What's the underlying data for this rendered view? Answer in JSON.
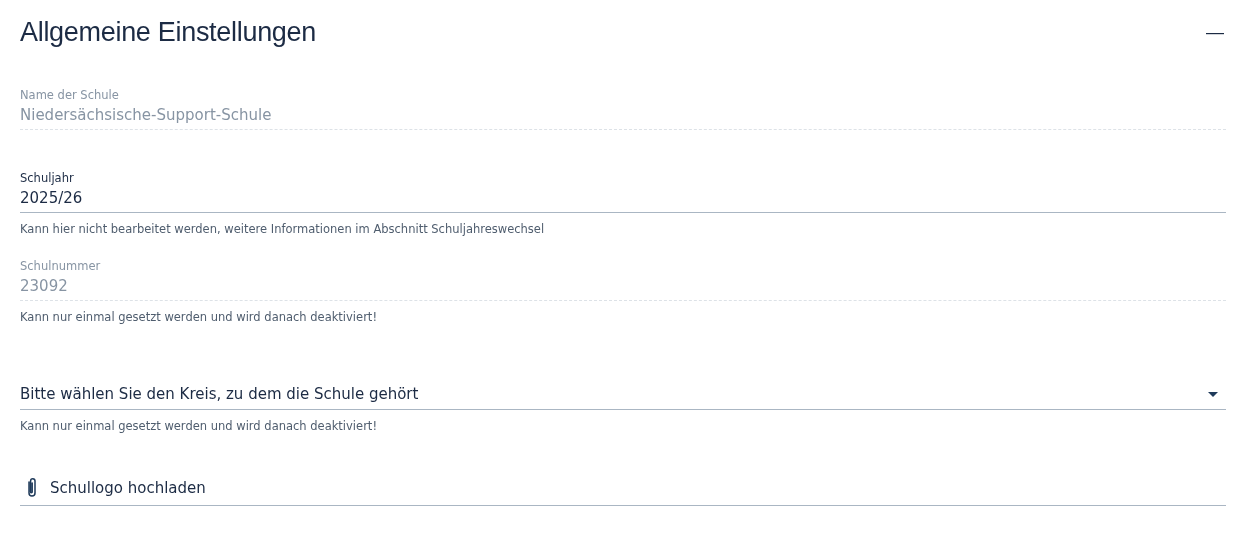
{
  "section": {
    "title": "Allgemeine Einstellungen",
    "expanded": true,
    "toggle": "—"
  },
  "fields": [
    {
      "kind": "text",
      "label": "Name der Schule",
      "value": "Niedersächsische-Support-Schule",
      "disabled": true
    },
    {
      "kind": "text",
      "label": "Schuljahr",
      "value": "2025/26",
      "disabled": false,
      "hint": "Kann hier nicht bearbeitet werden, weitere Informationen im Abschnitt Schuljahreswechsel"
    },
    {
      "kind": "text",
      "label": "Schulnummer",
      "value": "23092",
      "disabled": true,
      "hint": "Kann nur einmal gesetzt werden und wird danach deaktiviert!"
    },
    {
      "kind": "select",
      "placeholder": "Bitte wählen Sie den Kreis, zu dem die Schule gehört",
      "disabled": false,
      "hint": "Kann nur einmal gesetzt werden und wird danach deaktiviert!"
    },
    {
      "kind": "file",
      "label": "Schullogo hochladen"
    }
  ]
}
